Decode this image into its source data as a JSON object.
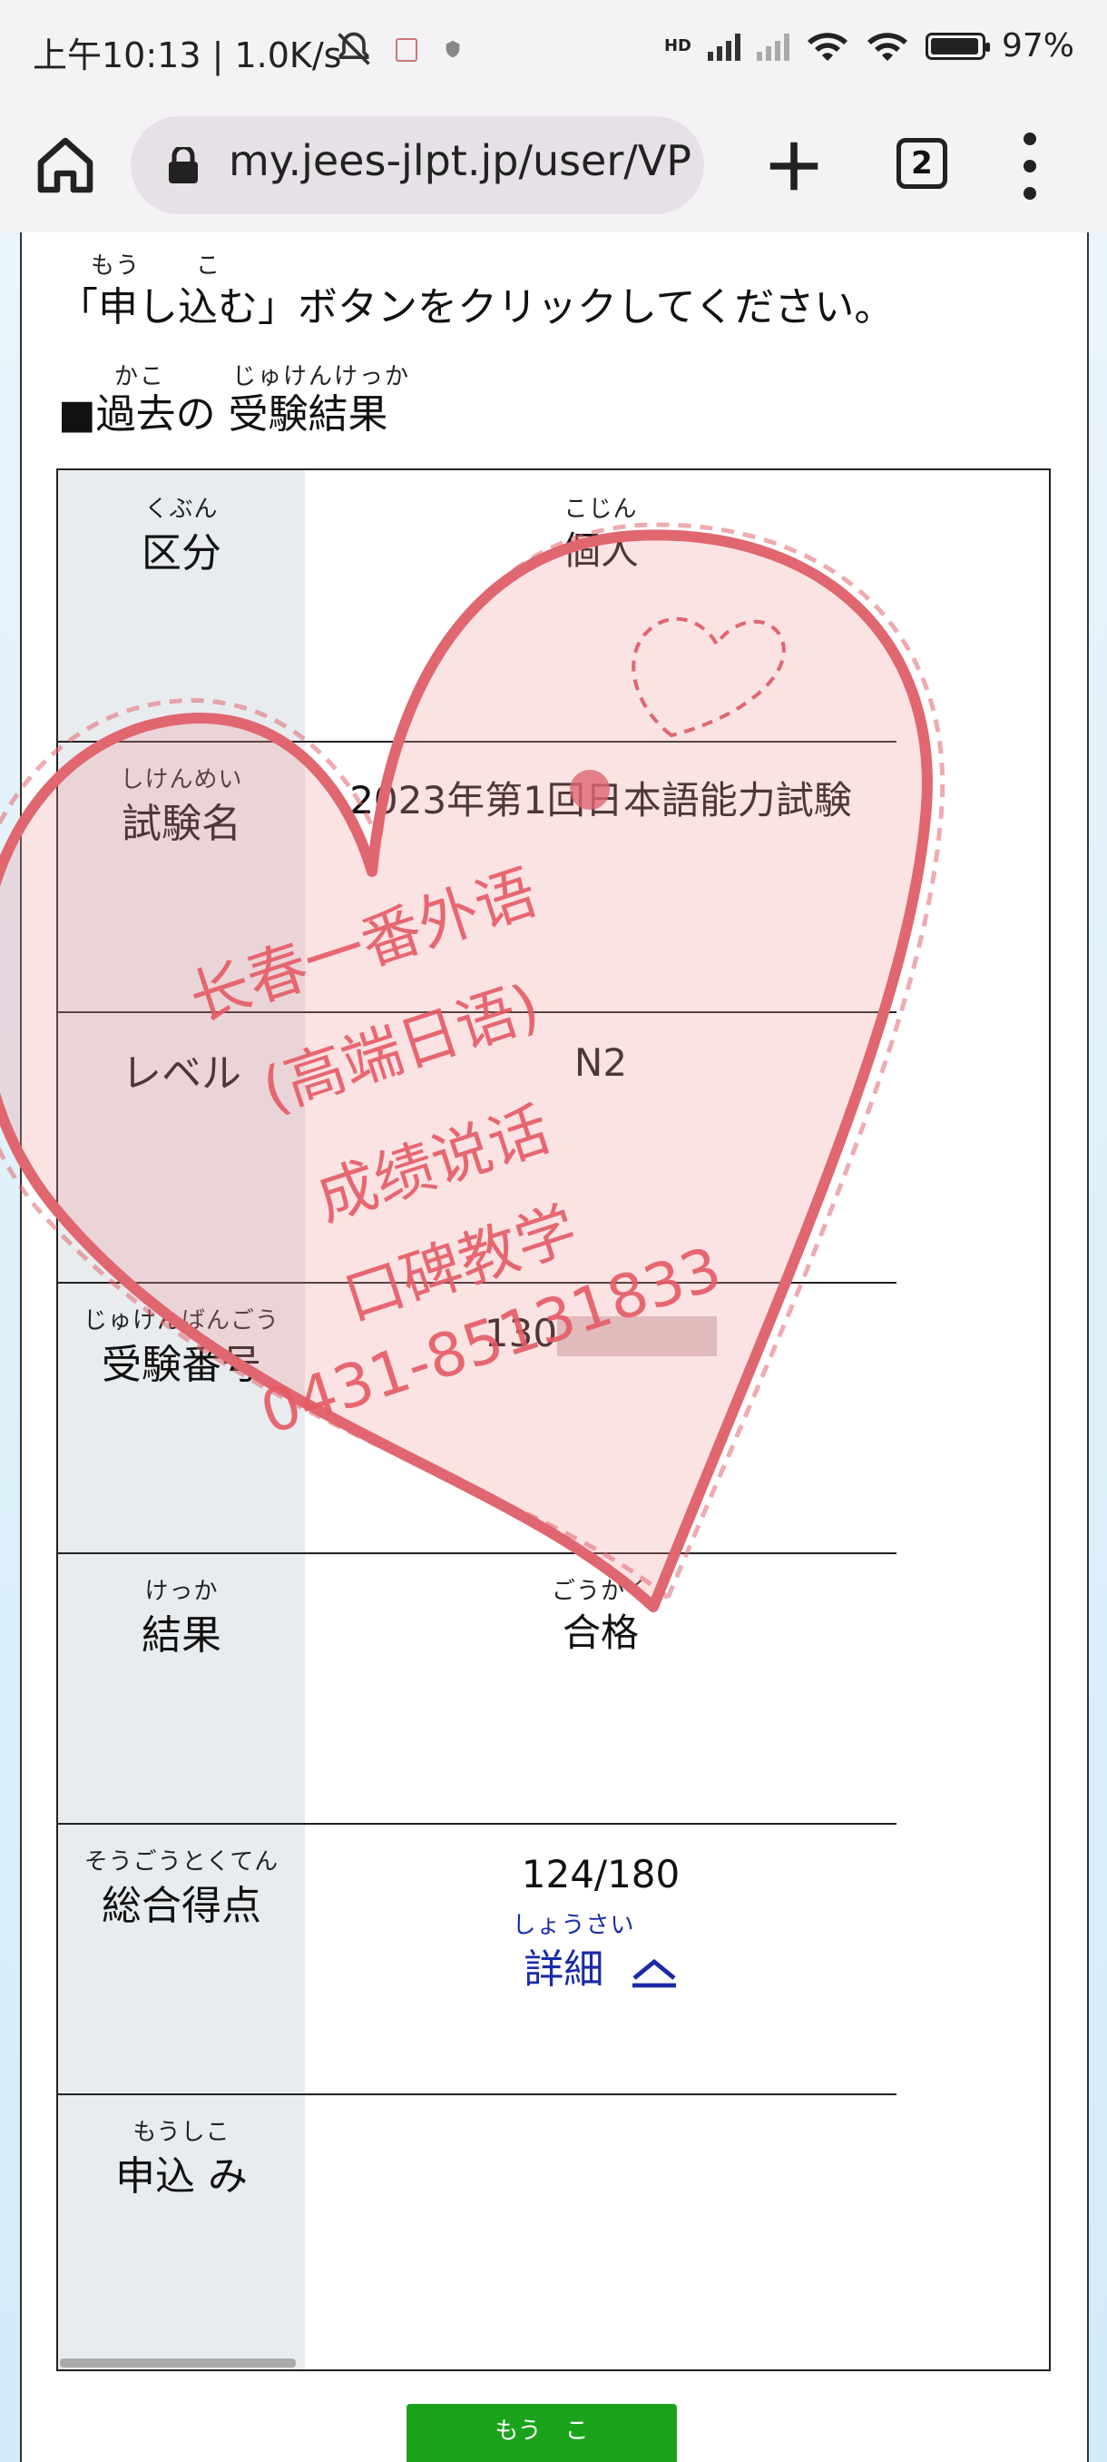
{
  "status_bar": {
    "left_text": "上午10:13 | 1.0K/s",
    "battery": "97%",
    "network_label": "HD"
  },
  "browser": {
    "url": "my.jees-jlpt.jp/user/VP",
    "tab_count": "2"
  },
  "page": {
    "intro_ruby_1": "もう",
    "intro_ruby_2": "こ",
    "intro_text": "「申し込む」ボタンをクリックしてください。",
    "heading_ruby_1": "かこ",
    "heading_ruby_2": "じゅけんけっか",
    "heading": "■過去の 受験結果"
  },
  "table": {
    "rows": [
      {
        "label_ruby": "くぶん",
        "label": "区分",
        "value_ruby": "こじん",
        "value": "個人"
      },
      {
        "label_ruby": "しけんめい",
        "label": "試験名",
        "value": "2023年第1回日本語能力試験"
      },
      {
        "label": "レベル",
        "value": "N2"
      },
      {
        "label_ruby": "じゅけんばんごう",
        "label": "受験番号",
        "value": "130"
      },
      {
        "label_ruby": "けっか",
        "label": "結果",
        "value_ruby": "ごうかく",
        "value": "合格"
      },
      {
        "label_ruby": "そうごうとくてん",
        "label": "総合得点",
        "value": "124/180",
        "detail_ruby": "しょうさい",
        "detail_label": "詳細"
      },
      {
        "label_ruby": "もうしこ",
        "label": "申込 み"
      }
    ]
  },
  "apply_button": {
    "label": "もう　こ"
  },
  "watermark": {
    "lines": [
      "长春一番外语",
      "(高端日语)",
      "成绩说话",
      "口碑教学",
      "0431-85131833"
    ],
    "color": "#e45a64"
  },
  "icons": [
    "home-icon",
    "lock-icon",
    "plus-icon",
    "tabs-icon",
    "more-vert-icon",
    "chevron-up-icon",
    "heart-icon",
    "mute-bell-icon",
    "wifi-icon",
    "battery-icon"
  ]
}
